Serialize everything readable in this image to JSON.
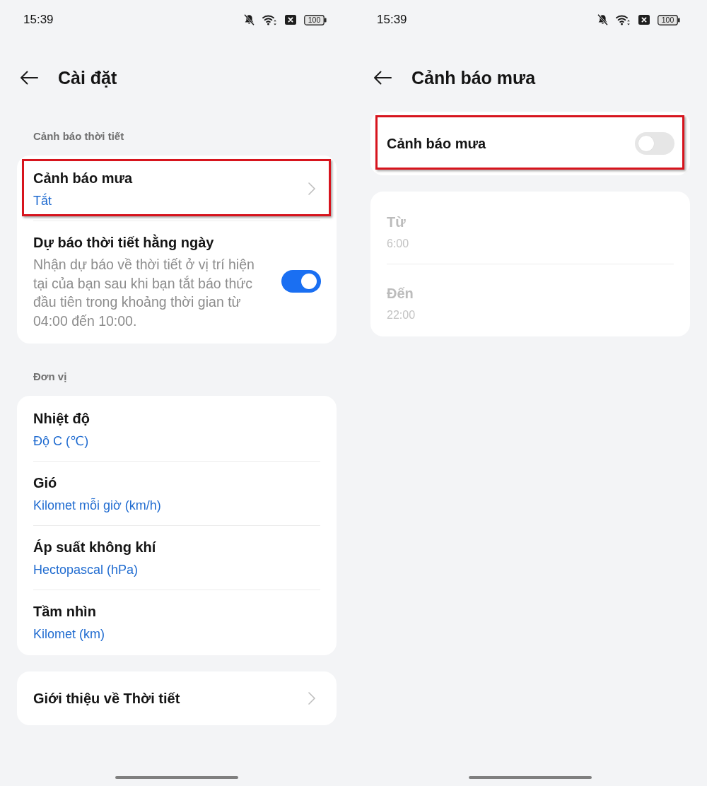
{
  "screens": [
    {
      "status_bar": {
        "time": "15:39",
        "battery": "100"
      },
      "header": {
        "title": "Cài đặt"
      },
      "sections": [
        {
          "heading": "Cảnh báo thời tiết",
          "items": [
            {
              "kind": "link",
              "title": "Cảnh báo mưa",
              "value": "Tắt",
              "highlighted": true
            },
            {
              "kind": "toggle",
              "title": "Dự báo thời tiết hằng ngày",
              "description": "Nhận dự báo về thời tiết ở vị trí hiện tại của bạn sau khi bạn tắt báo thức đầu tiên trong khoảng thời gian từ 04:00 đến 10:00.",
              "on": true,
              "highlighted": false
            }
          ]
        },
        {
          "heading": "Đơn vị",
          "items": [
            {
              "kind": "value",
              "title": "Nhiệt độ",
              "value": "Độ C (℃)"
            },
            {
              "kind": "value",
              "title": "Gió",
              "value": "Kilomet mỗi giờ (km/h)"
            },
            {
              "kind": "value",
              "title": "Áp suất không khí",
              "value": "Hectopascal (hPa)"
            },
            {
              "kind": "value",
              "title": "Tầm nhìn",
              "value": "Kilomet (km)"
            }
          ]
        },
        {
          "items": [
            {
              "kind": "link",
              "title": "Giới thiệu về Thời tiết"
            }
          ]
        }
      ]
    },
    {
      "status_bar": {
        "time": "15:39",
        "battery": "100"
      },
      "header": {
        "title": "Cảnh báo mưa"
      },
      "sections": [
        {
          "items": [
            {
              "kind": "toggle",
              "title": "Cảnh báo mưa",
              "on": false,
              "highlighted": true
            }
          ]
        },
        {
          "items": [
            {
              "kind": "time",
              "title": "Từ",
              "value": "6:00",
              "disabled": true
            },
            {
              "kind": "time",
              "title": "Đến",
              "value": "22:00",
              "disabled": true
            }
          ]
        }
      ]
    }
  ]
}
